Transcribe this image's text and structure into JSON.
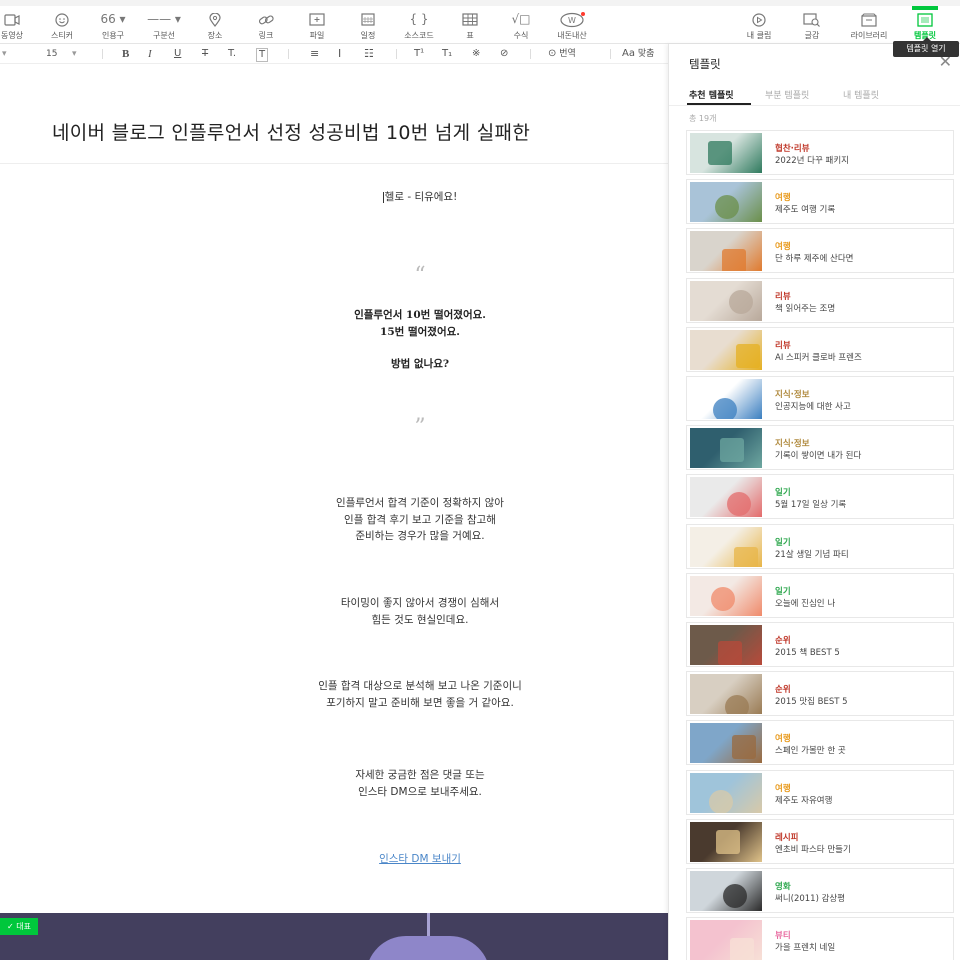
{
  "toolbar": {
    "items": [
      {
        "label": "동영상",
        "icon": "video-icon"
      },
      {
        "label": "스티커",
        "icon": "sticker-icon"
      },
      {
        "label": "인용구",
        "icon": "quote-icon",
        "glyph": "66 ▾"
      },
      {
        "label": "구분선",
        "icon": "divider-icon",
        "glyph": "—— ▾"
      },
      {
        "label": "장소",
        "icon": "location-icon"
      },
      {
        "label": "링크",
        "icon": "link-icon"
      },
      {
        "label": "파일",
        "icon": "file-icon"
      },
      {
        "label": "일정",
        "icon": "calendar-icon"
      },
      {
        "label": "소스코드",
        "icon": "code-icon",
        "glyph": "{ }"
      },
      {
        "label": "표",
        "icon": "table-icon"
      },
      {
        "label": "수식",
        "icon": "formula-icon",
        "glyph": "√□"
      },
      {
        "label": "내돈내산",
        "icon": "won-icon"
      }
    ],
    "right_items": [
      {
        "label": "내 클립",
        "icon": "clip-icon"
      },
      {
        "label": "글감",
        "icon": "material-icon"
      },
      {
        "label": "라이브러리",
        "icon": "library-icon"
      },
      {
        "label": "템플릿",
        "icon": "template-icon"
      }
    ],
    "tooltip": "템플릿 열기"
  },
  "format": {
    "font_size": "15",
    "bold": "B",
    "italic": "I",
    "underline": "U",
    "strike": "T",
    "text_color": "T.",
    "text_bg": "T",
    "align_center": "≡",
    "line_height": "I",
    "list": "☷",
    "superscript": "T¹",
    "subscript": "T₁",
    "special_char": "※",
    "link": "⊘",
    "translate": "번역",
    "spell": "맞춤"
  },
  "editor": {
    "title": "네이버 블로그 인플루언서 선정 성공비법 10번 넘게 실패한",
    "greeting": "헬로 - 티유에요!",
    "quote_open": "“",
    "quote_lines": [
      "인플루언서 10번 떨어졌어요.",
      "15번 떨어졌어요.",
      "",
      "방법 없나요?"
    ],
    "quote_close": "”",
    "paragraphs": [
      [
        "인플루언서 합격 기준이 정확하지 않아",
        "인플 합격 후기 보고 기준을 참고해",
        "준비하는 경우가 많을 거예요."
      ],
      [
        "타이밍이 좋지 않아서 경쟁이 심해서",
        "힘든 것도 현실인데요."
      ],
      [
        "인플 합격 대상으로 분석해 보고 나온 기준이니",
        "포기하지 말고 준비해 보면 좋을 거 같아요."
      ],
      [
        "자세한 궁금한 점은 댓글 또는",
        "인스타 DM으로 보내주세요."
      ]
    ],
    "link": "인스타 DM 보내기",
    "rep_badge": "✓ 대표"
  },
  "panel": {
    "title": "템플릿",
    "tabs": [
      "추천 템플릿",
      "부분 템플릿",
      "내 템플릿"
    ],
    "count": "총 19개",
    "colors": {
      "review": "#c0392b",
      "travel": "#e89a1d",
      "info": "#b08a3e",
      "diary": "#2fa84f",
      "rank": "#c0392b",
      "recipe": "#c0392b",
      "movie": "#2fa84f",
      "beauty": "#e86aa0"
    },
    "cards": [
      {
        "cat": "협찬·리뷰",
        "name": "2022년 다꾸 패키지",
        "color": "#c0392b",
        "thumb": [
          "#d7e4df",
          "#2f7a5e"
        ]
      },
      {
        "cat": "여행",
        "name": "제주도 여행 기록",
        "color": "#e89a1d",
        "thumb": [
          "#a9c3d8",
          "#6b8f4a"
        ]
      },
      {
        "cat": "여행",
        "name": "단 하루 제주에 산다면",
        "color": "#e89a1d",
        "thumb": [
          "#d9d4cc",
          "#e07a2e"
        ]
      },
      {
        "cat": "리뷰",
        "name": "책 읽어주는 조명",
        "color": "#c0392b",
        "thumb": [
          "#e4dcd3",
          "#b8a89a"
        ]
      },
      {
        "cat": "리뷰",
        "name": "AI 스피커 클로바 프렌즈",
        "color": "#c0392b",
        "thumb": [
          "#e8ddd0",
          "#e6b021"
        ]
      },
      {
        "cat": "지식·정보",
        "name": "인공지능에 대한 사고",
        "color": "#b08a3e",
        "thumb": [
          "#ffffff",
          "#3b7fc0"
        ]
      },
      {
        "cat": "지식·정보",
        "name": "기록이 쌓이면 내가 된다",
        "color": "#b08a3e",
        "thumb": [
          "#2f5f6e",
          "#6ea7a0"
        ]
      },
      {
        "cat": "일기",
        "name": "5월 17일 일상 기록",
        "color": "#2fa84f",
        "thumb": [
          "#eaeaea",
          "#e36b6b"
        ]
      },
      {
        "cat": "일기",
        "name": "21살 생일 기념 파티",
        "color": "#2fa84f",
        "thumb": [
          "#f4efe6",
          "#e8b548"
        ]
      },
      {
        "cat": "일기",
        "name": "오늘에 진심인 나",
        "color": "#2fa84f",
        "thumb": [
          "#f3e9e4",
          "#f08a6a"
        ]
      },
      {
        "cat": "순위",
        "name": "2015 책 BEST 5",
        "color": "#c0392b",
        "thumb": [
          "#6d5a4a",
          "#b84a3a"
        ]
      },
      {
        "cat": "순위",
        "name": "2015 맛집 BEST 5",
        "color": "#c0392b",
        "thumb": [
          "#d8cfc2",
          "#9a7b54"
        ]
      },
      {
        "cat": "여행",
        "name": "스페인 가볼만 한 곳",
        "color": "#e89a1d",
        "thumb": [
          "#7fa6c9",
          "#9a6a3e"
        ]
      },
      {
        "cat": "여행",
        "name": "제주도 자유여행",
        "color": "#e89a1d",
        "thumb": [
          "#9fc4da",
          "#d8c9a8"
        ]
      },
      {
        "cat": "레시피",
        "name": "엔초비 파스타 만들기",
        "color": "#c0392b",
        "thumb": [
          "#4a3a2e",
          "#e0c38a"
        ]
      },
      {
        "cat": "영화",
        "name": "써니(2011) 감상평",
        "color": "#2fa84f",
        "thumb": [
          "#cfd6db",
          "#2a2a2a"
        ]
      },
      {
        "cat": "뷰티",
        "name": "가을 프렌치 네일",
        "color": "#e86aa0",
        "thumb": [
          "#f4c2cf",
          "#f7e0d6"
        ]
      }
    ]
  }
}
